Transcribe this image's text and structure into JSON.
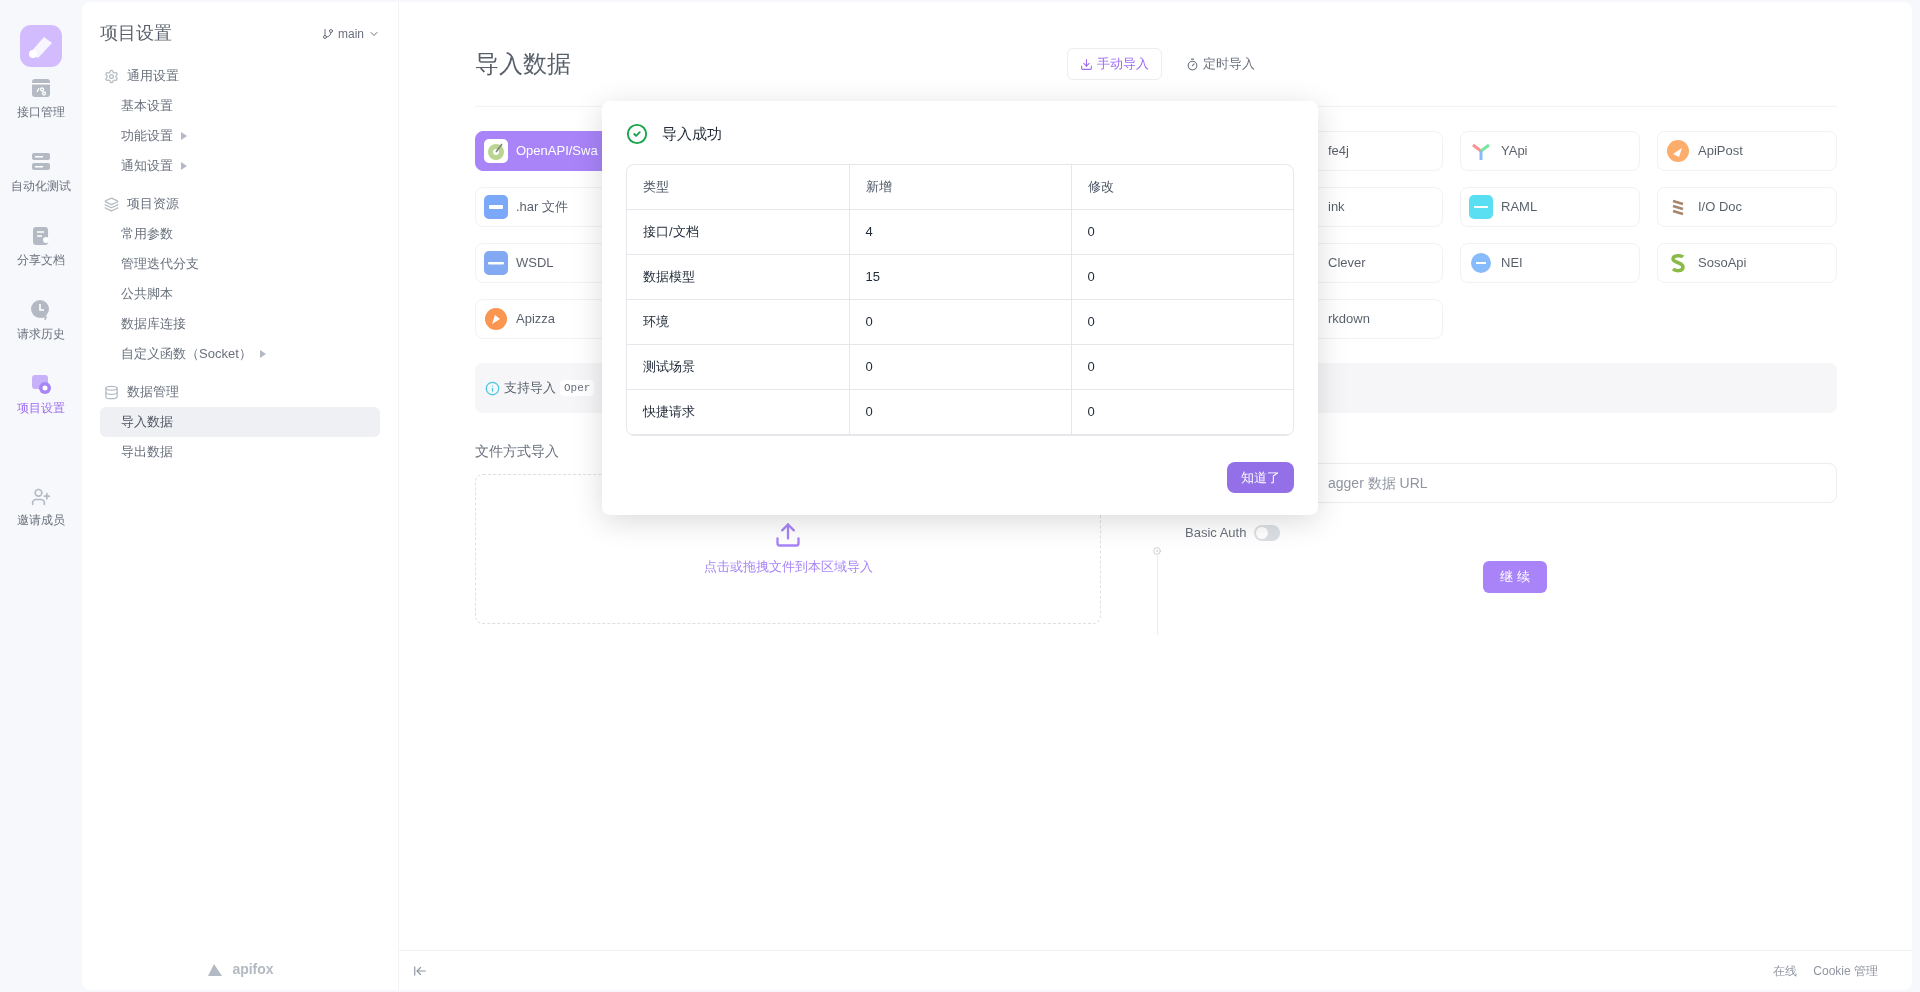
{
  "rail": [
    {
      "label": "接口管理",
      "selected": false
    },
    {
      "label": "自动化测试",
      "selected": false
    },
    {
      "label": "分享文档",
      "selected": false
    },
    {
      "label": "请求历史",
      "selected": false
    },
    {
      "label": "项目设置",
      "selected": true
    },
    {
      "label": "邀请成员",
      "selected": false
    }
  ],
  "sidebar": {
    "title": "项目设置",
    "branch": "main",
    "groups": [
      {
        "label": "通用设置",
        "children": [
          {
            "label": "基本设置",
            "selected": false,
            "submenu": false
          },
          {
            "label": "功能设置",
            "selected": false,
            "submenu": true
          },
          {
            "label": "通知设置",
            "selected": false,
            "submenu": true
          }
        ]
      },
      {
        "label": "项目资源",
        "children": [
          {
            "label": "常用参数",
            "selected": false,
            "submenu": false
          },
          {
            "label": "管理迭代分支",
            "selected": false,
            "submenu": false
          },
          {
            "label": "公共脚本",
            "selected": false,
            "submenu": false
          },
          {
            "label": "数据库连接",
            "selected": false,
            "submenu": false
          },
          {
            "label": "自定义函数（Socket）",
            "selected": false,
            "submenu": true
          }
        ]
      },
      {
        "label": "数据管理",
        "children": [
          {
            "label": "导入数据",
            "selected": true,
            "submenu": false
          },
          {
            "label": "导出数据",
            "selected": false,
            "submenu": false
          }
        ]
      }
    ],
    "footer": "apifox"
  },
  "main": {
    "title": "导入数据",
    "tabs": [
      {
        "label": "手动导入",
        "selected": true
      },
      {
        "label": "定时导入",
        "selected": false
      }
    ],
    "source_rows": [
      {
        "left": {
          "label": "OpenAPI/Swa",
          "selected": true
        },
        "right": [
          {
            "label": "fe4j",
            "kind": "cut",
            "selected": false
          },
          {
            "label": "YApi",
            "kind": "full",
            "selected": false
          },
          {
            "label": "ApiPost",
            "kind": "full",
            "selected": false
          }
        ]
      },
      {
        "left": {
          "label": ".har 文件",
          "selected": false
        },
        "right": [
          {
            "label": "ink",
            "kind": "cut",
            "selected": false
          },
          {
            "label": "RAML",
            "kind": "full",
            "selected": false
          },
          {
            "label": "I/O Doc",
            "kind": "full",
            "selected": false
          }
        ]
      },
      {
        "left": {
          "label": "WSDL",
          "selected": false
        },
        "right": [
          {
            "label": "Clever",
            "kind": "cut",
            "selected": false
          },
          {
            "label": "NEI",
            "kind": "full",
            "selected": false
          },
          {
            "label": "SosoApi",
            "kind": "full",
            "selected": false
          }
        ]
      },
      {
        "left": {
          "label": "Apizza",
          "selected": false
        },
        "right": [
          {
            "label": "rkdown",
            "kind": "cut",
            "selected": false
          }
        ]
      }
    ],
    "support": {
      "label": "支持导入",
      "tag": "Oper"
    },
    "file_import": {
      "title": "文件方式导入",
      "hint": "点击或拖拽文件到本区域导入"
    },
    "url_import": {
      "placeholder": "agger 数据 URL",
      "basic_auth_label": "Basic Auth",
      "basic_auth_on": false,
      "button": "继 续"
    }
  },
  "status_bar": {
    "items": [
      "在线",
      "Cookie 管理"
    ]
  },
  "dialog": {
    "title": "导入成功",
    "columns": [
      "类型",
      "新增",
      "修改"
    ],
    "rows": [
      [
        "接口/文档",
        "4",
        "0"
      ],
      [
        "数据模型",
        "15",
        "0"
      ],
      [
        "环境",
        "0",
        "0"
      ],
      [
        "测试场景",
        "0",
        "0"
      ],
      [
        "快捷请求",
        "0",
        "0"
      ]
    ],
    "button": "知道了"
  }
}
